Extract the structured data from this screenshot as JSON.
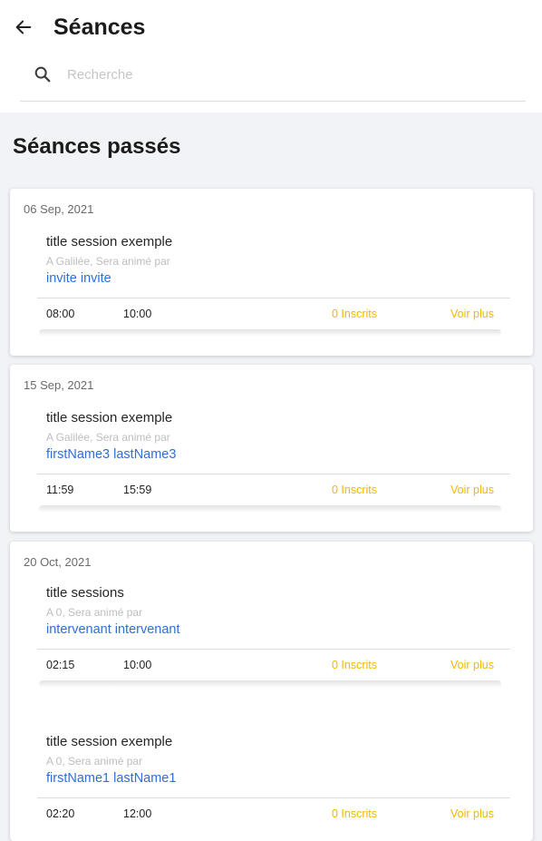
{
  "header": {
    "title": "Séances",
    "back_icon": "arrow-left-icon"
  },
  "search": {
    "placeholder": "Recherche",
    "value": "",
    "icon": "search-icon"
  },
  "section": {
    "title": "Séances passés"
  },
  "colors": {
    "link": "#2f6fd6",
    "accent": "#f2b705",
    "background": "#f2f3f6"
  },
  "groups": [
    {
      "date": "06 Sep, 2021",
      "sessions": [
        {
          "title": "title session exemple",
          "subtitle": "A Galilée, Sera animé par",
          "host": "invite invite",
          "start": "08:00",
          "end": "10:00",
          "registered": "0 Inscrits",
          "more": "Voir plus"
        }
      ]
    },
    {
      "date": "15 Sep, 2021",
      "sessions": [
        {
          "title": "title session exemple",
          "subtitle": "A Galilée, Sera animé par",
          "host": "firstName3 lastName3",
          "start": "11:59",
          "end": "15:59",
          "registered": "0 Inscrits",
          "more": "Voir plus"
        }
      ]
    },
    {
      "date": "20 Oct, 2021",
      "sessions": [
        {
          "title": "title sessions",
          "subtitle": "A 0, Sera animé par",
          "host": "intervenant intervenant",
          "start": "02:15",
          "end": "10:00",
          "registered": "0 Inscrits",
          "more": "Voir plus"
        },
        {
          "title": "title session exemple",
          "subtitle": "A 0, Sera animé par",
          "host": "firstName1 lastName1",
          "start": "02:20",
          "end": "12:00",
          "registered": "0 Inscrits",
          "more": "Voir plus"
        }
      ]
    }
  ]
}
